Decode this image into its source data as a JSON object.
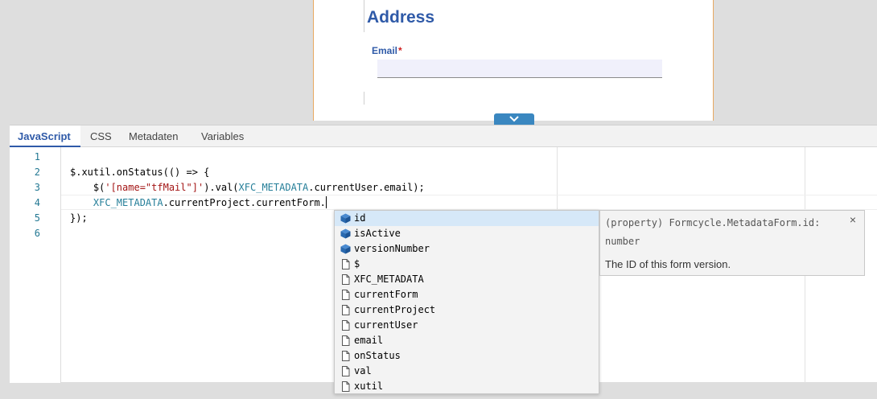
{
  "form": {
    "title": "Address",
    "email_label": "Email",
    "required_mark": "*",
    "email_value": "",
    "email_placeholder": ""
  },
  "collapse_icon": "chevron-down-icon",
  "tabs": [
    {
      "label": "JavaScript",
      "active": true
    },
    {
      "label": "CSS",
      "active": false
    },
    {
      "label": "Metadaten",
      "active": false
    },
    {
      "label": "Variables",
      "active": false
    }
  ],
  "editor": {
    "line_numbers": [
      "1",
      "2",
      "3",
      "4",
      "5",
      "6"
    ],
    "lines": {
      "l2": "$.xutil.onStatus(() => {",
      "l3_a": "    $(",
      "l3_str": "'[name=\"tfMail\"]'",
      "l3_b": ").val(",
      "l3_meta": "XFC_METADATA",
      "l3_c": ".currentUser.email);",
      "l4_meta": "XFC_METADATA",
      "l4_b": ".currentProject.currentForm.",
      "l5": "});"
    }
  },
  "suggestions": [
    {
      "label": "id",
      "icon": "property-cube-icon",
      "selected": true
    },
    {
      "label": "isActive",
      "icon": "property-cube-icon",
      "selected": false
    },
    {
      "label": "versionNumber",
      "icon": "property-cube-icon",
      "selected": false
    },
    {
      "label": "$",
      "icon": "text-file-icon",
      "selected": false
    },
    {
      "label": "XFC_METADATA",
      "icon": "text-file-icon",
      "selected": false
    },
    {
      "label": "currentForm",
      "icon": "text-file-icon",
      "selected": false
    },
    {
      "label": "currentProject",
      "icon": "text-file-icon",
      "selected": false
    },
    {
      "label": "currentUser",
      "icon": "text-file-icon",
      "selected": false
    },
    {
      "label": "email",
      "icon": "text-file-icon",
      "selected": false
    },
    {
      "label": "onStatus",
      "icon": "text-file-icon",
      "selected": false
    },
    {
      "label": "val",
      "icon": "text-file-icon",
      "selected": false
    },
    {
      "label": "xutil",
      "icon": "text-file-icon",
      "selected": false
    }
  ],
  "details": {
    "signature": "(property) Formcycle.MetadataForm.id: number",
    "doc": "The ID of this form version.",
    "close": "×"
  },
  "colors": {
    "accent": "#2f5aa8",
    "selection": "#d6e8f8",
    "string": "#a31515",
    "metadata": "#267f99"
  }
}
